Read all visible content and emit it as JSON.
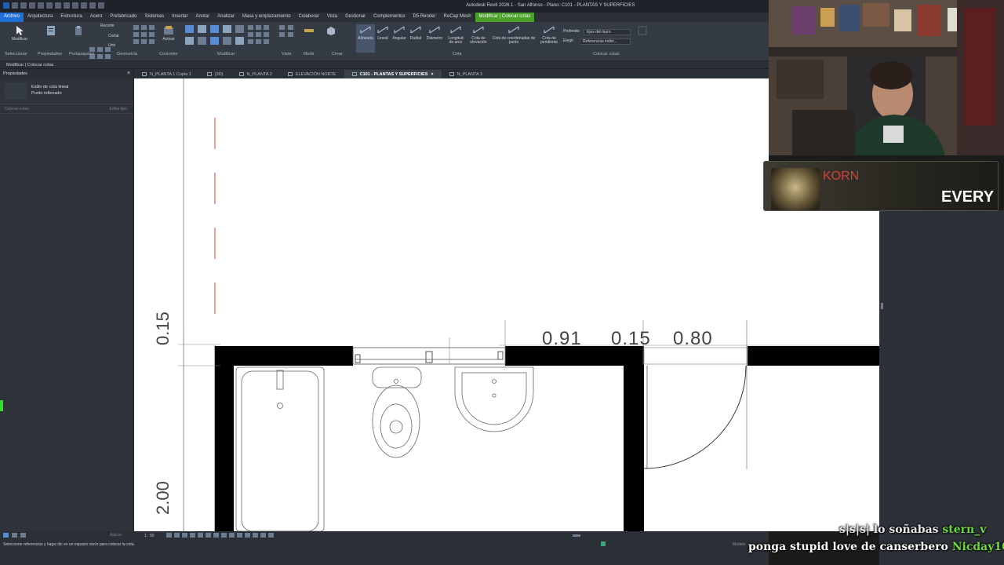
{
  "window": {
    "title": "Autodesk Revit 2026.1 - San Alfonso - Plano: C101 - PLANTAS Y SUPERFICIES"
  },
  "menu": {
    "tabs": [
      "Archivo",
      "Arquitectura",
      "Estructura",
      "Acero",
      "Prefabricado",
      "Sistemas",
      "Insertar",
      "Anotar",
      "Analizar",
      "Masa y emplazamiento",
      "Colaborar",
      "Vista",
      "Gestionar",
      "Complementos",
      "D5 Render",
      "ReCap Mesh",
      "Modificar | Colocar cotas"
    ]
  },
  "ribbon": {
    "modify_label": "Modificar",
    "select_label": "Seleccionar",
    "properties_label": "Propiedades",
    "clipboard_label": "Portapapeles",
    "geometry_label": "Geometría",
    "controls_label": "Controles",
    "modify_panel_label": "Modificar",
    "view_label": "Vista",
    "measure_label": "Medir",
    "create_label": "Crear",
    "cota_panel_label": "Cota",
    "place_dims_panel_label": "Colocar cotas",
    "trim_label": "Recorte",
    "cut_label": "Cortar",
    "join_label": "Unir",
    "activate_label": "Activar",
    "dim_tools": [
      "Alineada",
      "Lineal",
      "Angular",
      "Radial",
      "Diámetro",
      "Longitud de arco",
      "Cota de elevación",
      "Cota de coordenadas de punto",
      "Cota de pendiente"
    ],
    "preferred_label": "Preferido:",
    "preferred_value": "Ejes del muro",
    "pick_label": "Elegir:",
    "pick_value": "Referencias indivi..."
  },
  "context_bar": {
    "text": "Modificar | Colocar cotas"
  },
  "properties": {
    "header": "Propiedades",
    "type_line1": "Estilo de cota lineal",
    "type_line2": "Punto rellenado",
    "filter_placeholder": "Colocar cotas",
    "edit_type": "Editar tipo"
  },
  "view_tabs": [
    {
      "label": "N_PLANTA 1 Copia 1",
      "active": false
    },
    {
      "label": "{3D}",
      "active": false
    },
    {
      "label": "N_PLANTA 2",
      "active": false
    },
    {
      "label": "ELEVACIÓN NORTE",
      "active": false
    },
    {
      "label": "C101 - PLANTAS Y SUPERFICIES",
      "active": true
    },
    {
      "label": "N_PLANTA 3",
      "active": false
    }
  ],
  "drawing": {
    "dims_top": [
      "0.91",
      "0.15",
      "0.80"
    ],
    "dim_left_top": "0.15",
    "dim_left_bottom": "2.00"
  },
  "status": {
    "message": "Seleccione referencias y haga clic en un espacio vacío para colocar la cota.",
    "apply": "Aplicar",
    "scale": "1 : 50",
    "model": "Modelo"
  },
  "overlay": {
    "now_playing": {
      "artist": "KORN",
      "song": "EVERY"
    },
    "chat": [
      {
        "message": "s|s|s| lo soñabas",
        "user": "stern_v"
      },
      {
        "message": "ponga stupid love de canserbero",
        "user": "Nicday10"
      }
    ]
  },
  "colors": {
    "revit_file_tab": "#1e6fd8",
    "context_tab": "#4aa02a",
    "chat_user": "#6cdb3b",
    "artist_red": "#d0423a"
  }
}
